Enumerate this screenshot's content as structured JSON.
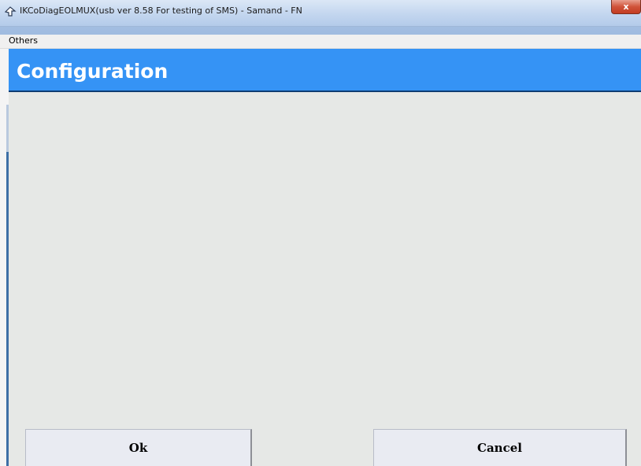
{
  "window": {
    "title": "IKCoDiagEOLMUX(usb ver 8.58 For testing of SMS)  - Samand - FN",
    "close_label": "x",
    "icon": "app-logo-icon"
  },
  "menu": {
    "items": [
      {
        "label": "Others"
      }
    ]
  },
  "header": {
    "title": "Configuration",
    "background_color": "#3593f5"
  },
  "buttons": {
    "ok_label": "Ok",
    "cancel_label": "Cancel"
  }
}
